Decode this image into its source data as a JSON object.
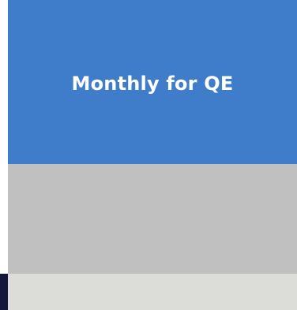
{
  "card": {
    "title": "Monthly for QE"
  },
  "colors": {
    "header_bg": "#3f7dca",
    "body_bg": "#bfc0bf",
    "footer_bg": "#dcdcd8",
    "left_strip": "#13173a"
  }
}
